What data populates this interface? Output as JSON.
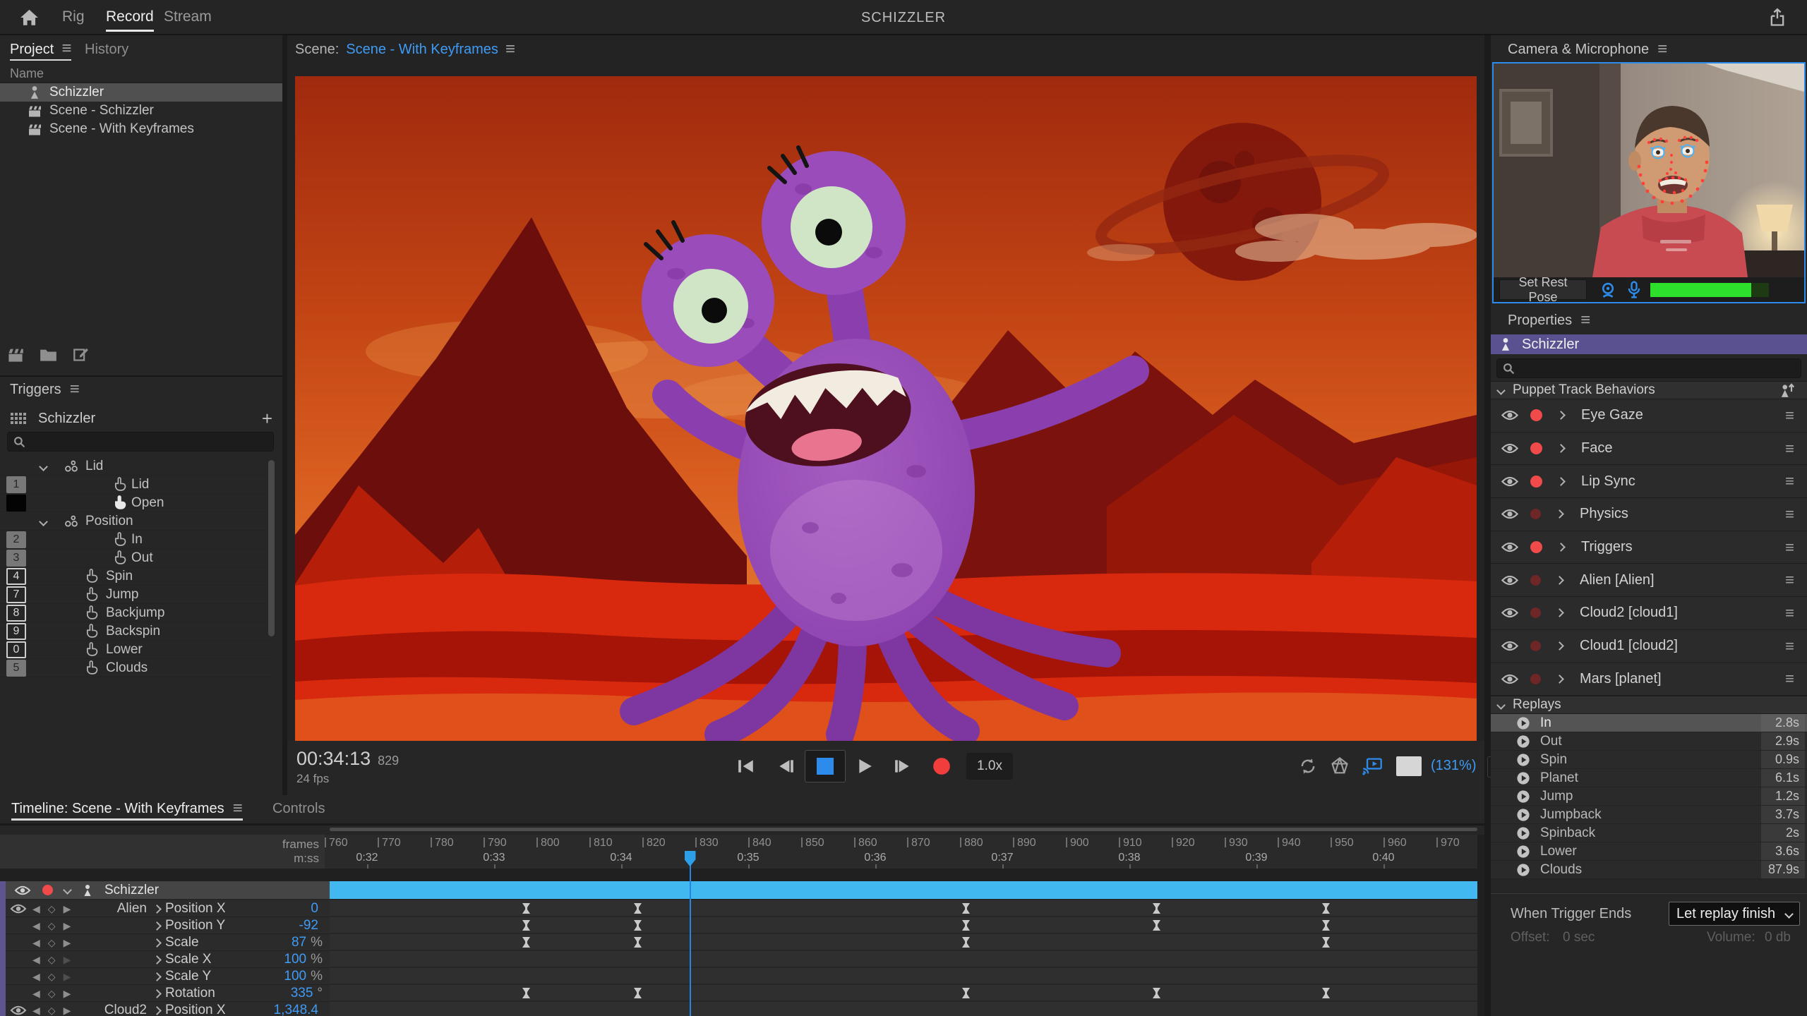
{
  "topbar": {
    "title": "SCHIZZLER",
    "tabs": [
      {
        "label": "Rig",
        "active": false
      },
      {
        "label": "Record",
        "active": true
      },
      {
        "label": "Stream",
        "active": false
      }
    ]
  },
  "project_panel": {
    "tab_project": "Project",
    "tab_history": "History",
    "column_header": "Name",
    "items": [
      {
        "name": "Schizzler",
        "icon": "puppet",
        "selected": true
      },
      {
        "name": "Scene - Schizzler",
        "icon": "scene",
        "selected": false
      },
      {
        "name": "Scene - With Keyframes",
        "icon": "scene",
        "selected": false
      }
    ]
  },
  "triggers_panel": {
    "title": "Triggers",
    "puppet_name": "Schizzler",
    "add_label": "+",
    "rows": [
      {
        "badge": "",
        "badge_style": "none",
        "label": "Lid",
        "kind": "group",
        "active": false
      },
      {
        "badge": "1",
        "badge_style": "filled",
        "label": "Lid",
        "kind": "child",
        "active": false
      },
      {
        "badge": "",
        "badge_style": "black",
        "label": "Open",
        "kind": "child",
        "active": true
      },
      {
        "badge": "",
        "badge_style": "none",
        "label": "Position",
        "kind": "group",
        "active": false
      },
      {
        "badge": "2",
        "badge_style": "filled",
        "label": "In",
        "kind": "child",
        "active": false
      },
      {
        "badge": "3",
        "badge_style": "filled",
        "label": "Out",
        "kind": "child",
        "active": false
      },
      {
        "badge": "4",
        "badge_style": "outline",
        "label": "Spin",
        "kind": "root",
        "active": false
      },
      {
        "badge": "7",
        "badge_style": "outline",
        "label": "Jump",
        "kind": "root",
        "active": false
      },
      {
        "badge": "8",
        "badge_style": "outline",
        "label": "Backjump",
        "kind": "root",
        "active": false
      },
      {
        "badge": "9",
        "badge_style": "outline",
        "label": "Backspin",
        "kind": "root",
        "active": false
      },
      {
        "badge": "0",
        "badge_style": "outline",
        "label": "Lower",
        "kind": "root",
        "active": false
      },
      {
        "badge": "5",
        "badge_style": "filled",
        "label": "Clouds",
        "kind": "root",
        "active": false
      }
    ]
  },
  "scene_panel": {
    "label": "Scene:",
    "name": "Scene - With Keyframes"
  },
  "playback": {
    "timecode": "00:34:13",
    "frame": "829",
    "fps": "24 fps",
    "speed": "1.0x",
    "zoom": "(131%)"
  },
  "camera_panel": {
    "title": "Camera & Microphone",
    "set_rest_pose": "Set Rest Pose"
  },
  "properties": {
    "title": "Properties",
    "puppet_name": "Schizzler",
    "behaviors_header": "Puppet Track Behaviors",
    "behaviors": [
      {
        "name": "Eye Gaze",
        "armed": true
      },
      {
        "name": "Face",
        "armed": true
      },
      {
        "name": "Lip Sync",
        "armed": true
      },
      {
        "name": "Physics",
        "armed": false
      },
      {
        "name": "Triggers",
        "armed": true
      },
      {
        "name": "Alien [Alien]",
        "armed": false
      },
      {
        "name": "Cloud2 [cloud1]",
        "armed": false
      },
      {
        "name": "Cloud1 [cloud2]",
        "armed": false
      },
      {
        "name": "Mars [planet]",
        "armed": false
      }
    ],
    "replays_header": "Replays",
    "replays": [
      {
        "name": "In",
        "duration": "2.8s",
        "selected": true
      },
      {
        "name": "Out",
        "duration": "2.9s",
        "selected": false
      },
      {
        "name": "Spin",
        "duration": "0.9s",
        "selected": false
      },
      {
        "name": "Planet",
        "duration": "6.1s",
        "selected": false
      },
      {
        "name": "Jump",
        "duration": "1.2s",
        "selected": false
      },
      {
        "name": "Jumpback",
        "duration": "3.7s",
        "selected": false
      },
      {
        "name": "Spinback",
        "duration": "2s",
        "selected": false
      },
      {
        "name": "Lower",
        "duration": "3.6s",
        "selected": false
      },
      {
        "name": "Clouds",
        "duration": "87.9s",
        "selected": false
      }
    ],
    "when_trigger_ends": {
      "label": "When Trigger Ends",
      "value": "Let replay finish",
      "offset_label": "Offset:",
      "offset_value": "0 sec",
      "volume_label": "Volume:",
      "volume_value": "0 db"
    }
  },
  "timeline": {
    "tab_label": "Timeline: Scene - With Keyframes",
    "controls_label": "Controls",
    "track_name": "Schizzler",
    "playhead_frame": 829,
    "ruler": {
      "frames_label": "frames",
      "mss_label": "m:ss",
      "tick_first": 760,
      "tick_last": 970,
      "tick_step": 10,
      "time_labels": [
        {
          "frame": 768,
          "label": "0:32"
        },
        {
          "frame": 792,
          "label": "0:33"
        },
        {
          "frame": 816,
          "label": "0:34"
        },
        {
          "frame": 840,
          "label": "0:35"
        },
        {
          "frame": 864,
          "label": "0:36"
        },
        {
          "frame": 888,
          "label": "0:37"
        },
        {
          "frame": 912,
          "label": "0:38"
        },
        {
          "frame": 936,
          "label": "0:39"
        },
        {
          "frame": 960,
          "label": "0:40"
        }
      ]
    },
    "rows": [
      {
        "group": "Alien",
        "prop": "Position X",
        "value": "0",
        "suffix": "",
        "eye": true,
        "dim_next": false,
        "keyframes": [
          798,
          819,
          881,
          917,
          949
        ]
      },
      {
        "group": "",
        "prop": "Position Y",
        "value": "-92",
        "suffix": "",
        "eye": false,
        "dim_next": false,
        "keyframes": [
          798,
          819,
          881,
          917,
          949
        ]
      },
      {
        "group": "",
        "prop": "Scale",
        "value": "87",
        "suffix": "%",
        "eye": false,
        "dim_next": false,
        "keyframes": [
          798,
          819,
          881,
          949
        ]
      },
      {
        "group": "",
        "prop": "Scale X",
        "value": "100",
        "suffix": "%",
        "eye": false,
        "dim_next": true,
        "keyframes": []
      },
      {
        "group": "",
        "prop": "Scale Y",
        "value": "100",
        "suffix": "%",
        "eye": false,
        "dim_next": true,
        "keyframes": []
      },
      {
        "group": "",
        "prop": "Rotation",
        "value": "335",
        "suffix": "°",
        "eye": false,
        "dim_next": false,
        "keyframes": [
          798,
          819,
          881,
          917,
          949
        ]
      },
      {
        "group": "Cloud2",
        "prop": "Position X",
        "value": "1,348.4",
        "suffix": "",
        "eye": true,
        "dim_next": false,
        "keyframes": []
      }
    ]
  },
  "colors": {
    "accent_blue": "#3f9bf5",
    "record_red": "#f04a4a",
    "take_cyan": "#41b8ef",
    "puppet_purple": "#5a5191",
    "meter_green": "#2ce02c",
    "playhead_blue": "#2d9fe8"
  }
}
